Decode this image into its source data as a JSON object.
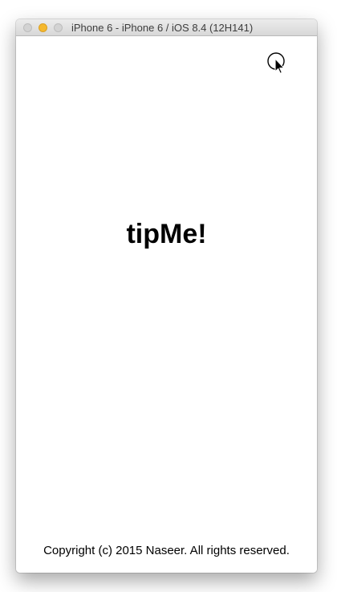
{
  "window": {
    "title": "iPhone 6 - iPhone 6 / iOS 8.4 (12H141)",
    "traffic_light_colors": {
      "close": "#d3d3d3",
      "minimize": "#f5b82e",
      "zoom": "#d3d3d3"
    }
  },
  "app": {
    "title": "tipMe!",
    "copyright": "Copyright (c) 2015 Naseer. All rights reserved."
  },
  "cursor": {
    "icon": "tap-cursor-icon"
  }
}
